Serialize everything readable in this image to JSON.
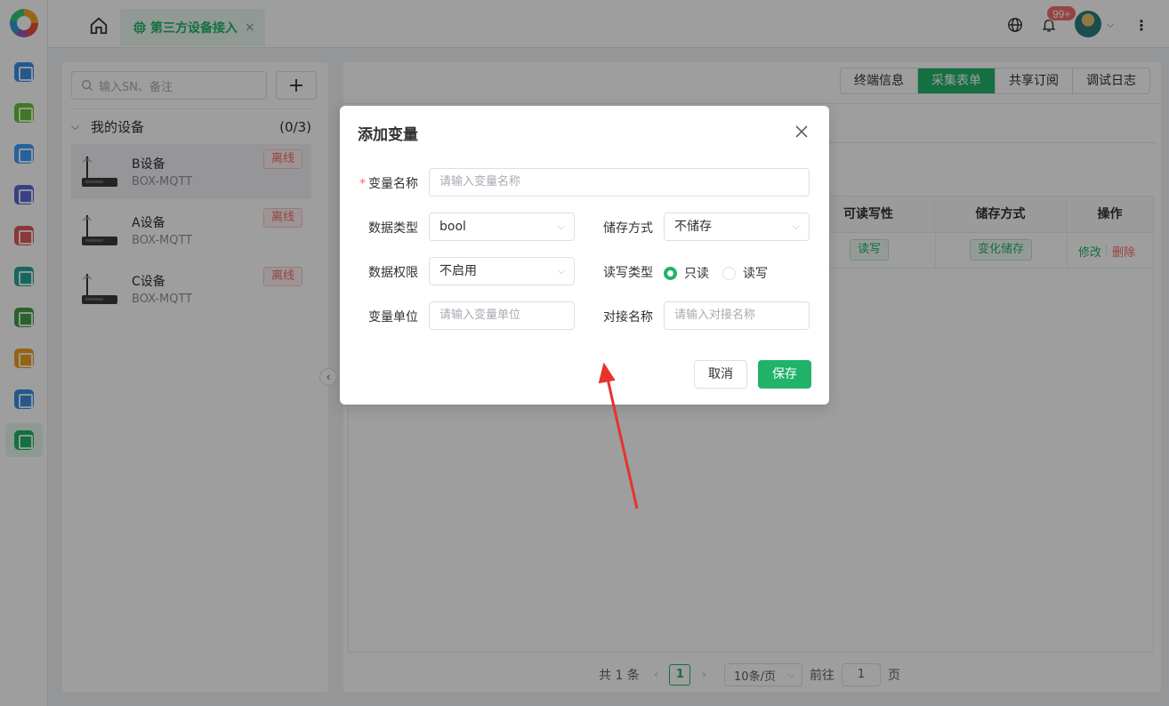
{
  "topbar": {
    "active_tab": "第三方设备接入",
    "tab_close": "×",
    "notification_count": "99+"
  },
  "sidebar": {
    "icons": [
      {
        "name": "home-icon",
        "color": "#3a8ee6"
      },
      {
        "name": "device-icon",
        "color": "#67c23a"
      },
      {
        "name": "apps-icon",
        "color": "#409eff"
      },
      {
        "name": "chart-icon",
        "color": "#5b6ad6"
      },
      {
        "name": "alarm-icon",
        "color": "#e05b5b"
      },
      {
        "name": "monitor-icon",
        "color": "#26a69a"
      },
      {
        "name": "flow-icon",
        "color": "#43a047"
      },
      {
        "name": "tools-icon",
        "color": "#f0a020"
      },
      {
        "name": "calendar-icon",
        "color": "#3a8ee6"
      },
      {
        "name": "chip-icon",
        "color": "#21b36a"
      }
    ]
  },
  "devices": {
    "search_placeholder": "输入SN、备注",
    "add_label": "+",
    "group_name": "我的设备",
    "group_count": "(0/3)",
    "items": [
      {
        "name": "B设备",
        "model": "BOX-MQTT",
        "status": "离线"
      },
      {
        "name": "A设备",
        "model": "BOX-MQTT",
        "status": "离线"
      },
      {
        "name": "C设备",
        "model": "BOX-MQTT",
        "status": "离线"
      }
    ]
  },
  "main": {
    "tabs": [
      "终端信息",
      "采集表单",
      "共享订阅",
      "调试日志"
    ],
    "active_tab": "采集表单",
    "table_headers": {
      "rw": "可读写性",
      "storage": "储存方式",
      "ops": "操作"
    },
    "row": {
      "rw": "读写",
      "storage": "变化储存",
      "edit": "修改",
      "delete": "删除"
    }
  },
  "pager": {
    "total": "共 1 条",
    "page": "1",
    "page_size": "10条/页",
    "goto_label": "前往",
    "goto_value": "1",
    "page_unit": "页"
  },
  "dialog": {
    "title": "添加变量",
    "fields": {
      "var_name_label": "变量名称",
      "var_name_placeholder": "请输入变量名称",
      "data_type_label": "数据类型",
      "data_type_value": "bool",
      "storage_label": "储存方式",
      "storage_value": "不储存",
      "permission_label": "数据权限",
      "permission_value": "不启用",
      "rw_label": "读写类型",
      "rw_options": [
        "只读",
        "读写"
      ],
      "rw_selected": "只读",
      "unit_label": "变量单位",
      "unit_placeholder": "请输入变量单位",
      "dock_label": "对接名称",
      "dock_placeholder": "请输入对接名称"
    },
    "cancel": "取消",
    "save": "保存"
  },
  "colors": {
    "accent": "#21b36a",
    "danger": "#f56c6c",
    "annotation_arrow": "#e8322d"
  }
}
